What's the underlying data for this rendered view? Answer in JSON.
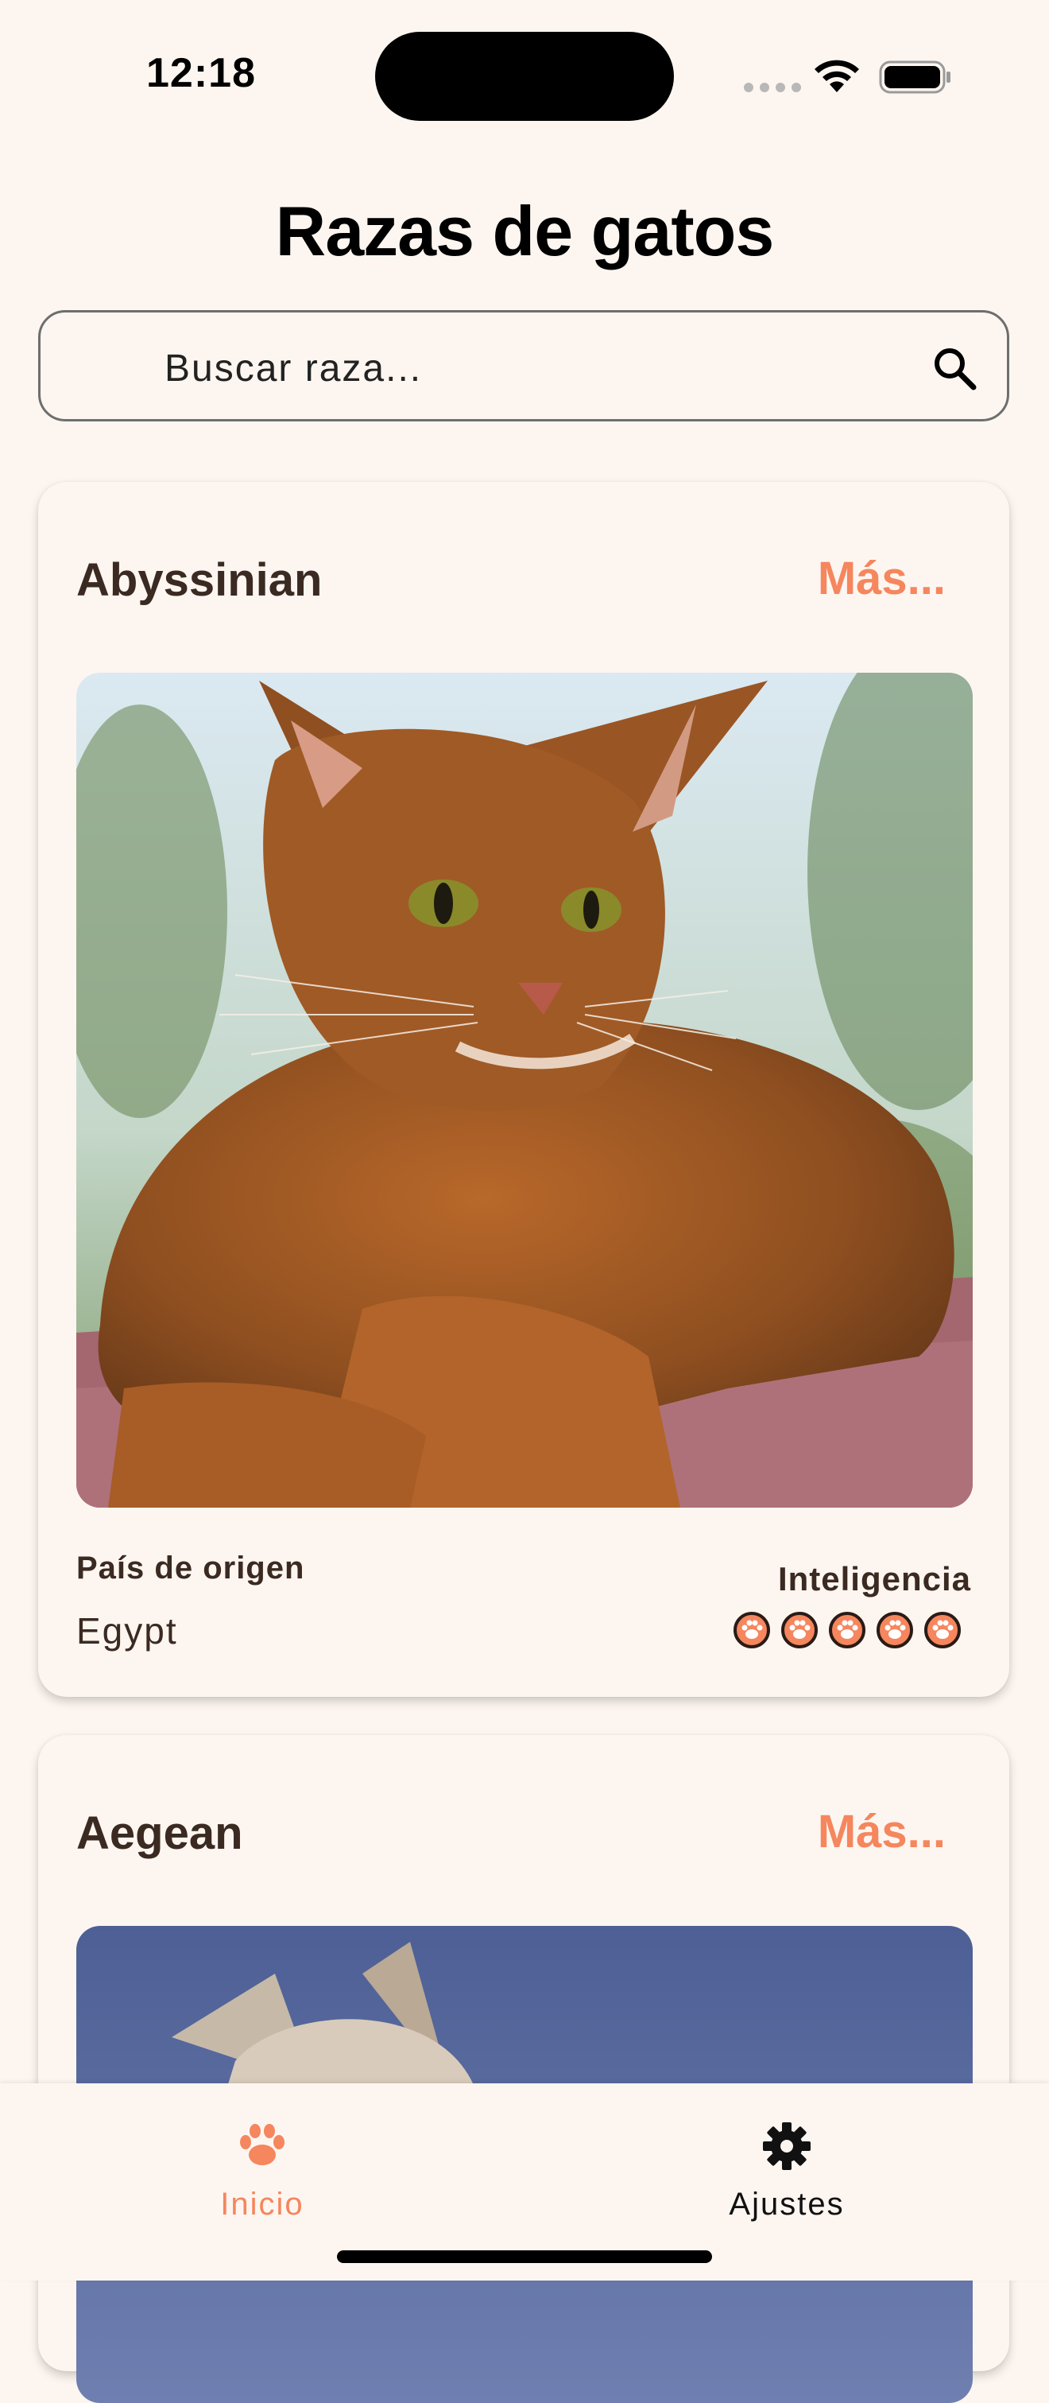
{
  "status_bar": {
    "time": "12:18"
  },
  "header": {
    "title": "Razas de gatos"
  },
  "search": {
    "placeholder": "Buscar raza..."
  },
  "colors": {
    "accent": "#F5865E",
    "background": "#FDF6F0",
    "text_dark": "#3a2a22"
  },
  "breeds": [
    {
      "name": "Abyssinian",
      "more_label": "Más...",
      "origin_label": "País de origen",
      "origin": "Egypt",
      "intelligence_label": "Inteligencia",
      "intelligence_level": 5,
      "intelligence_max": 5
    },
    {
      "name": "Aegean",
      "more_label": "Más..."
    }
  ],
  "tab_bar": {
    "tabs": [
      {
        "label": "Inicio",
        "icon": "paw-icon",
        "active": true
      },
      {
        "label": "Ajustes",
        "icon": "gear-icon",
        "active": false
      }
    ]
  }
}
